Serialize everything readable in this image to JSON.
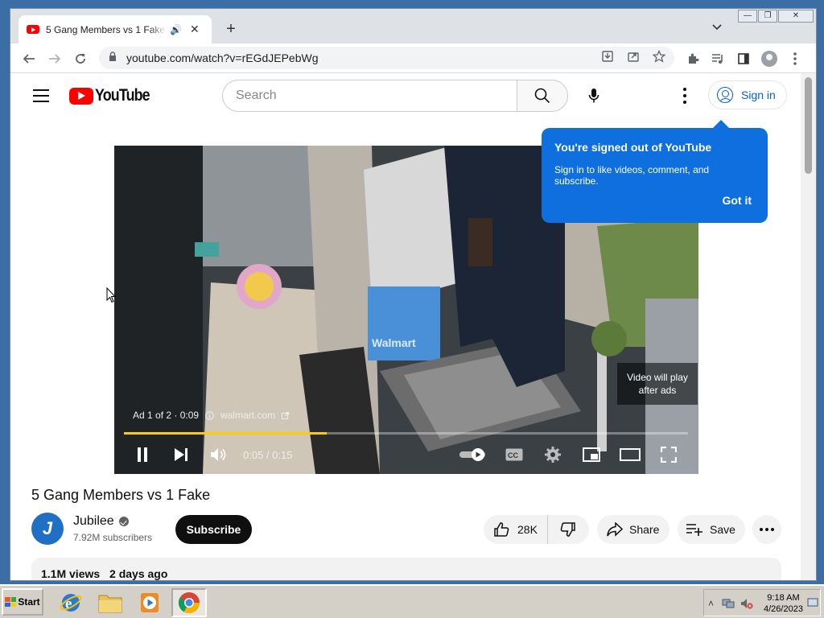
{
  "browser": {
    "tab_title": "5 Gang Members vs 1 Fake - YouTube",
    "tab_audio_icon": "speaker-icon",
    "url": "youtube.com/watch?v=rEGdJEPebWg"
  },
  "youtube": {
    "logo_text": "YouTube",
    "search_placeholder": "Search",
    "sign_in_label": "Sign in"
  },
  "tooltip": {
    "title": "You're signed out of YouTube",
    "body": "Sign in to like videos, comment, and subscribe.",
    "button": "Got it"
  },
  "player": {
    "ad_label": "Ad 1 of 2 · 0:09",
    "ad_site": "walmart.com",
    "skip_line1": "Video will play",
    "skip_line2": "after ads",
    "time": "0:05 / 0:15",
    "progress_fraction": 0.36,
    "box_text": "Walmart"
  },
  "video": {
    "title": "5 Gang Members vs 1 Fake",
    "channel_initial": "J",
    "channel": "Jubilee",
    "subscribers": "7.92M subscribers",
    "subscribe_label": "Subscribe",
    "likes": "28K",
    "share_label": "Share",
    "save_label": "Save",
    "views": "1.1M views",
    "posted": "2 days ago"
  },
  "taskbar": {
    "start_label": "Start",
    "time": "9:18 AM",
    "date": "4/26/2023"
  },
  "colors": {
    "youtube_red": "#ff0000",
    "tooltip_blue": "#0f6fde",
    "link_blue": "#065fd4",
    "ad_progress": "#ffcc00"
  }
}
